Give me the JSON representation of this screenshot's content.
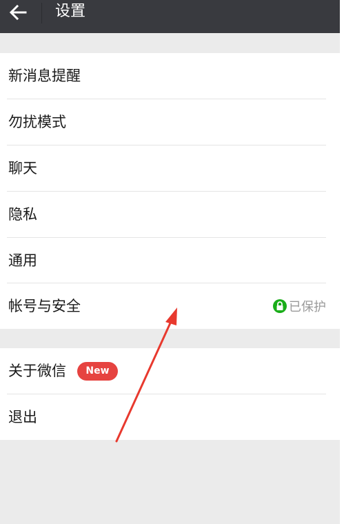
{
  "header": {
    "title": "设置",
    "back_icon": "arrow-left-icon"
  },
  "menu_group_1": [
    {
      "label": "新消息提醒"
    },
    {
      "label": "勿扰模式"
    },
    {
      "label": "聊天"
    },
    {
      "label": "隐私"
    },
    {
      "label": "通用"
    },
    {
      "label": "帐号与安全",
      "status_text": "已保护",
      "status_icon": "lock-icon",
      "status_color": "#1aad19"
    }
  ],
  "menu_group_2": [
    {
      "label": "关于微信",
      "badge": "New",
      "badge_color": "#e64340"
    },
    {
      "label": "退出"
    }
  ],
  "colors": {
    "titlebar": "#393a3f",
    "page_background": "#ebebeb",
    "annotation_arrow": "#e8392e"
  }
}
